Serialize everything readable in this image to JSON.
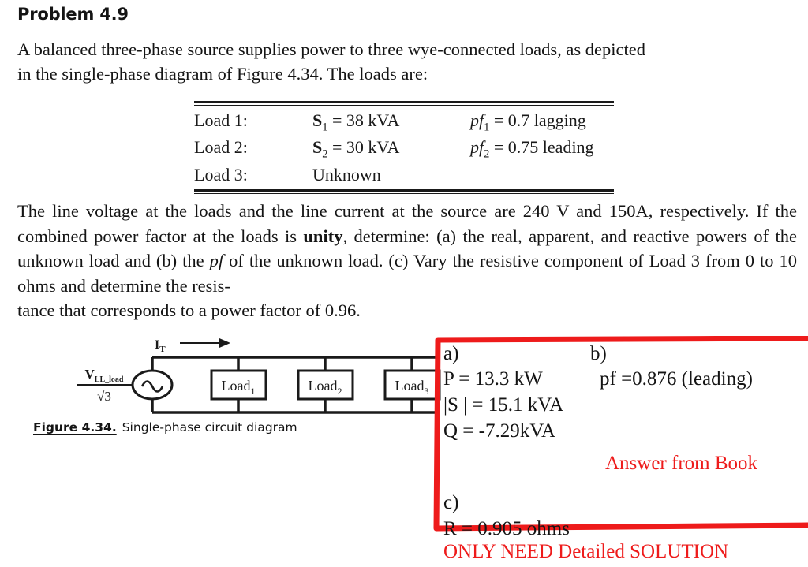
{
  "title": "Problem 4.9",
  "intro": {
    "line1": "A balanced three-phase source supplies power to three wye-connected loads, as depicted",
    "line2": "in the single-phase diagram of Figure 4.34. The loads are:"
  },
  "loads_table": {
    "rows": [
      {
        "name": "Load 1:",
        "s_var": "S",
        "s_sub": "1",
        "s_value": " = 38 kVA",
        "pf_var": "pf",
        "pf_sub": "1",
        "pf_value": " = 0.7 lagging"
      },
      {
        "name": "Load 2:",
        "s_var": "S",
        "s_sub": "2",
        "s_value": " = 30 kVA",
        "pf_var": "pf",
        "pf_sub": "2",
        "pf_value": " = 0.75 leading"
      },
      {
        "name": "Load 3:",
        "s_var": "",
        "s_sub": "",
        "s_value": "Unknown",
        "pf_var": "",
        "pf_sub": "",
        "pf_value": ""
      }
    ]
  },
  "body": {
    "seg1": "The line voltage at the loads and the line current at the source are 240 V and 150A, respectively. If the combined power factor at the loads is ",
    "unity": "unity",
    "seg2": ", determine: (a) the real, apparent, and reactive powers of the unknown load and (b) the ",
    "pf_italic": "pf",
    "seg3": " of the unknown load. (c) Vary the resistive component of Load 3 from 0 to 10 ohms and determine the resis-",
    "seg4": "tance that corresponds to a power factor of 0.96."
  },
  "circuit": {
    "current_label": "I",
    "current_sub": "T",
    "source_numerator": "V",
    "source_numerator_sub": "LL_load",
    "source_denominator": "3",
    "source_radical": "√",
    "loads": [
      {
        "label": "Load",
        "sub": "1"
      },
      {
        "label": "Load",
        "sub": "2"
      },
      {
        "label": "Load",
        "sub": "3"
      }
    ]
  },
  "figure_caption": {
    "number": "Figure 4.34.",
    "text": "Single-phase circuit diagram"
  },
  "answer_box": {
    "part_a_label": "a)",
    "part_b_label": "b)",
    "real_power": "P  = 13.3 kW",
    "power_factor": "pf  =0.876 (leading)",
    "apparent_power": "|S | = 15.1 kVA",
    "reactive_power": "Q  = -7.29kVA",
    "source_note": "Answer from Book",
    "part_c_label": "c)",
    "resistance": "R  = 0.905 ohms",
    "border_color": "#ee1b1b"
  },
  "footer_note": "ONLY NEED Detailed SOLUTION"
}
